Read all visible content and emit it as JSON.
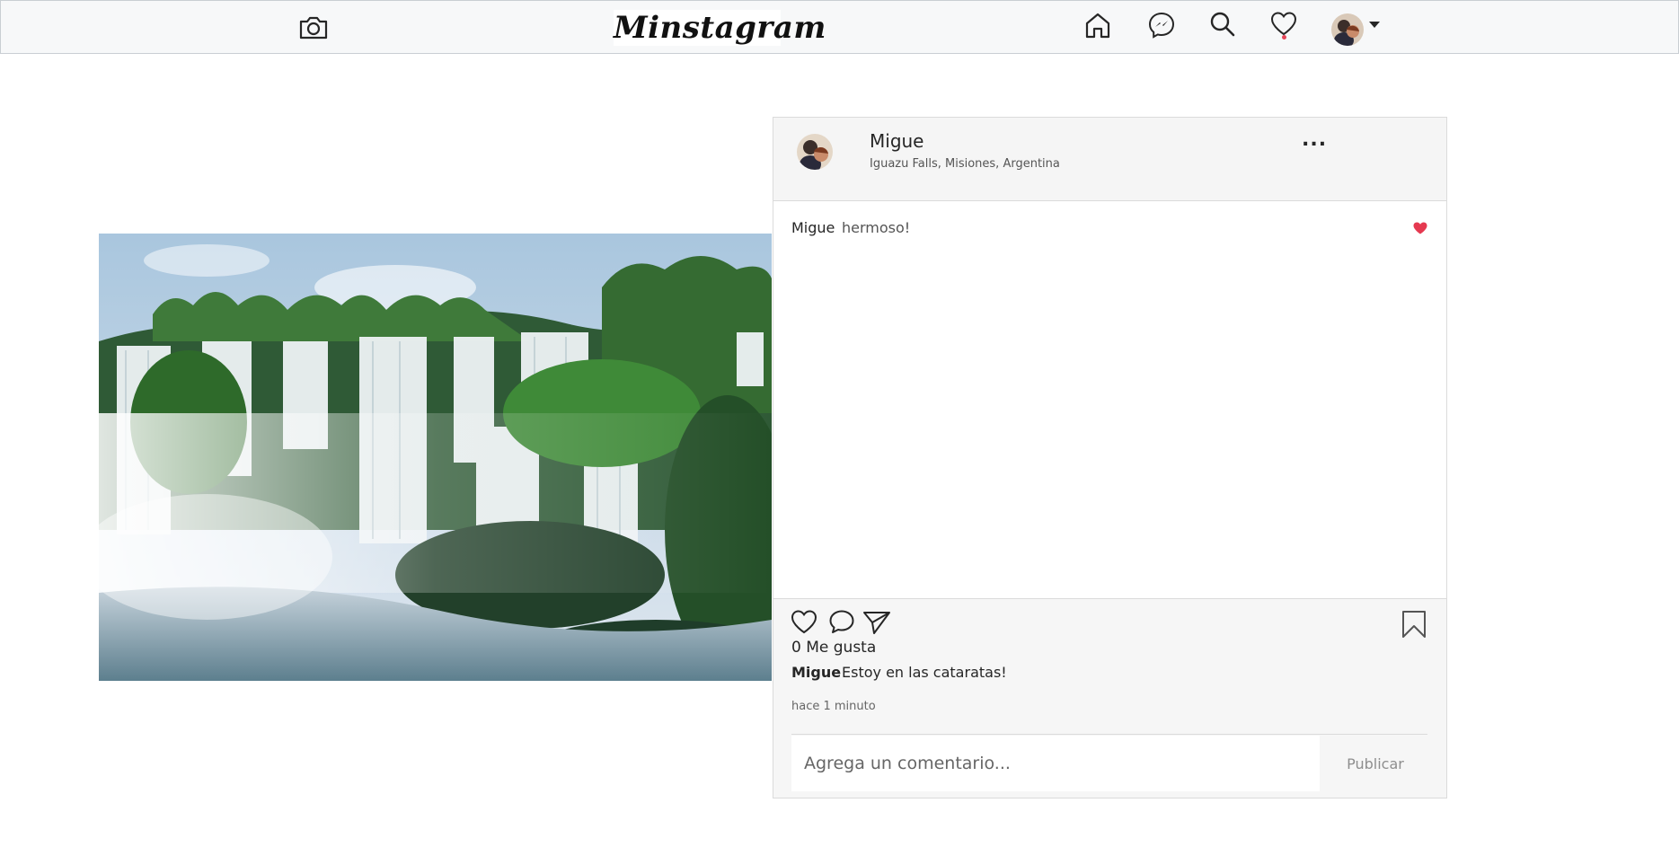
{
  "navbar": {
    "logo_text": "Minstagram",
    "icons": [
      "camera-icon",
      "home-icon",
      "messenger-icon",
      "search-icon",
      "heart-icon",
      "avatar"
    ],
    "notification_color": "#e64457"
  },
  "post": {
    "username": "Migue",
    "location": "Iguazu Falls, Misiones, Argentina",
    "more_label": "...",
    "comments": [
      {
        "user": "Migue",
        "text": "hermoso!",
        "liked": true
      }
    ],
    "likes_text": "0 Me gusta",
    "caption_user": "Migue",
    "caption_text": "Estoy en las cataratas!",
    "time_ago": "hace 1 minuto",
    "comment_placeholder": "Agrega un comentario...",
    "publish_label": "Publicar"
  },
  "colors": {
    "like_red": "#e53950",
    "border": "#dbdbdb",
    "nav_bg": "#f7f8f9"
  }
}
